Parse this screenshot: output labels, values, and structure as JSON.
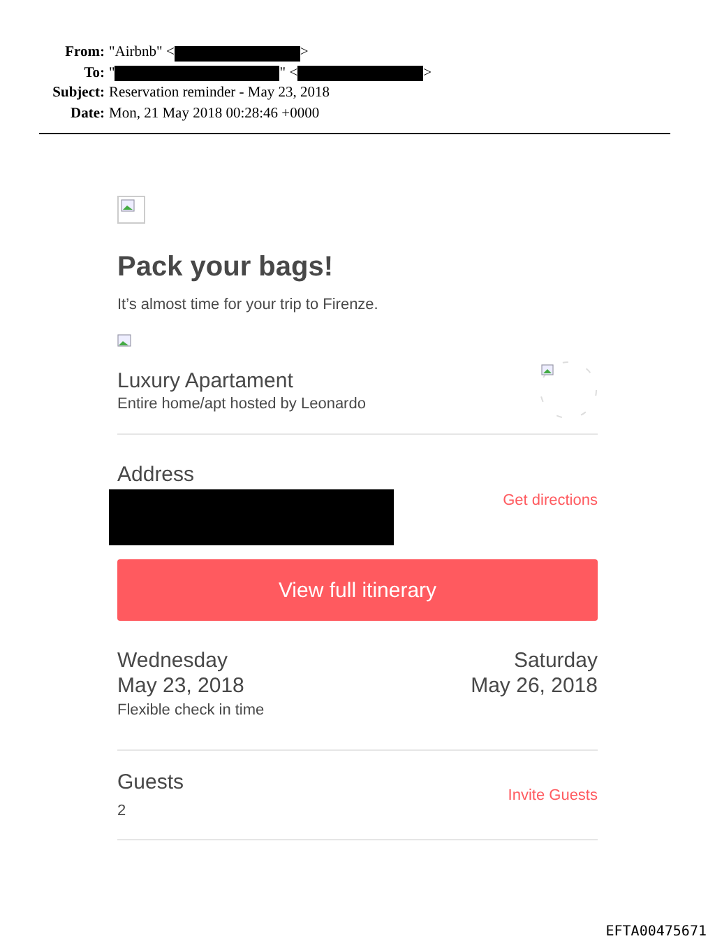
{
  "headers": [
    {
      "label": "From:",
      "parts": [
        {
          "kind": "text",
          "text": "\"Airbnb\" <"
        },
        {
          "kind": "redaction"
        },
        {
          "kind": "text",
          "text": ">"
        }
      ]
    },
    {
      "label": "To:",
      "parts": [
        {
          "kind": "text",
          "text": "\""
        },
        {
          "kind": "redaction"
        },
        {
          "kind": "text",
          "text": "\" <"
        },
        {
          "kind": "redaction"
        },
        {
          "kind": "text",
          "text": ">"
        }
      ]
    },
    {
      "label": "Subject:",
      "parts": [
        {
          "kind": "text",
          "text": "Reservation reminder - May 23, 2018"
        }
      ]
    },
    {
      "label": "Date:",
      "parts": [
        {
          "kind": "text",
          "text": "Mon, 21 May 2018 00:28:46 +0000"
        }
      ]
    }
  ],
  "email": {
    "title": "Pack your bags!",
    "subtitle": "It’s almost time for your trip to Firenze.",
    "listing": {
      "name": "Luxury Apartament",
      "detail": "Entire home/apt hosted by Leonardo"
    },
    "address": {
      "label": "Address",
      "link": "Get directions"
    },
    "button": "View full itinerary",
    "checkin": {
      "day": "Wednesday",
      "date": "May 23, 2018",
      "note": "Flexible check in time"
    },
    "checkout": {
      "day": "Saturday",
      "date": "May 26, 2018"
    },
    "guests": {
      "label": "Guests",
      "count": "2",
      "link": "Invite Guests"
    }
  },
  "footer_id": "EFTA00475671"
}
